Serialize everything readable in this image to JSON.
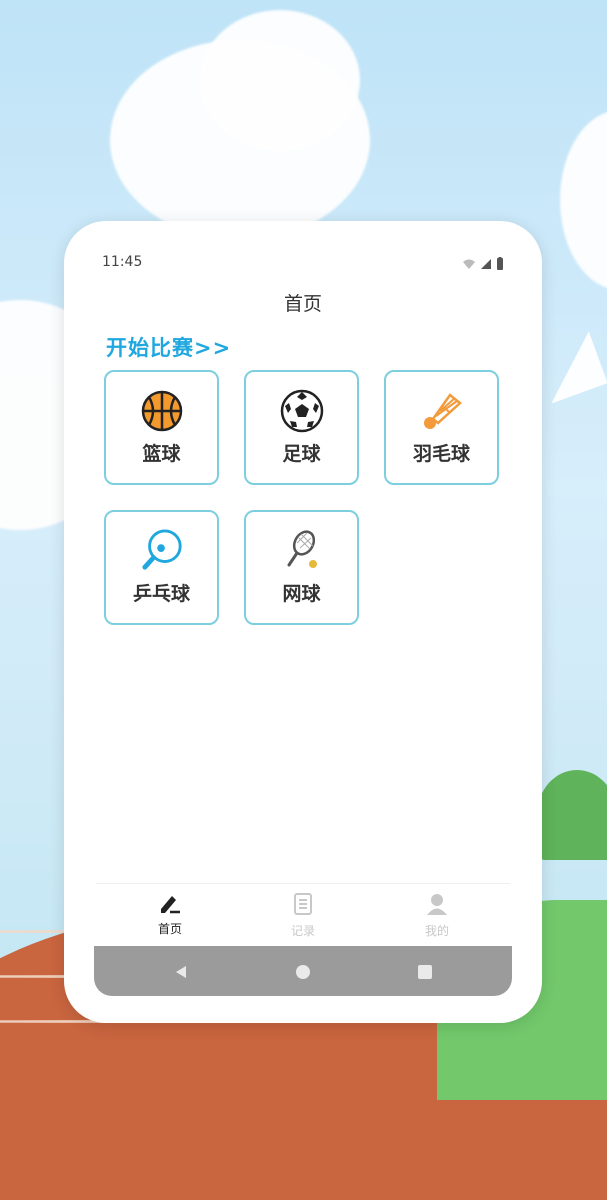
{
  "status_bar": {
    "time": "11:45"
  },
  "header": {
    "title": "首页"
  },
  "section": {
    "heading": "开始比赛>>"
  },
  "sports": [
    {
      "label": "篮球",
      "icon": "basketball-icon"
    },
    {
      "label": "足球",
      "icon": "soccer-ball-icon"
    },
    {
      "label": "羽毛球",
      "icon": "shuttlecock-icon"
    },
    {
      "label": "乒乓球",
      "icon": "ping-pong-paddle-icon"
    },
    {
      "label": "网球",
      "icon": "tennis-racket-icon"
    }
  ],
  "bottom_nav": [
    {
      "label": "首页",
      "icon": "edit-pen-icon",
      "active": true
    },
    {
      "label": "记录",
      "icon": "notebook-icon",
      "active": false
    },
    {
      "label": "我的",
      "icon": "user-icon",
      "active": false
    }
  ],
  "colors": {
    "accent": "#1fa7df",
    "tile_border": "#7dcfe0",
    "nav_inactive": "#c8c8c8",
    "nav_active": "#222222"
  }
}
